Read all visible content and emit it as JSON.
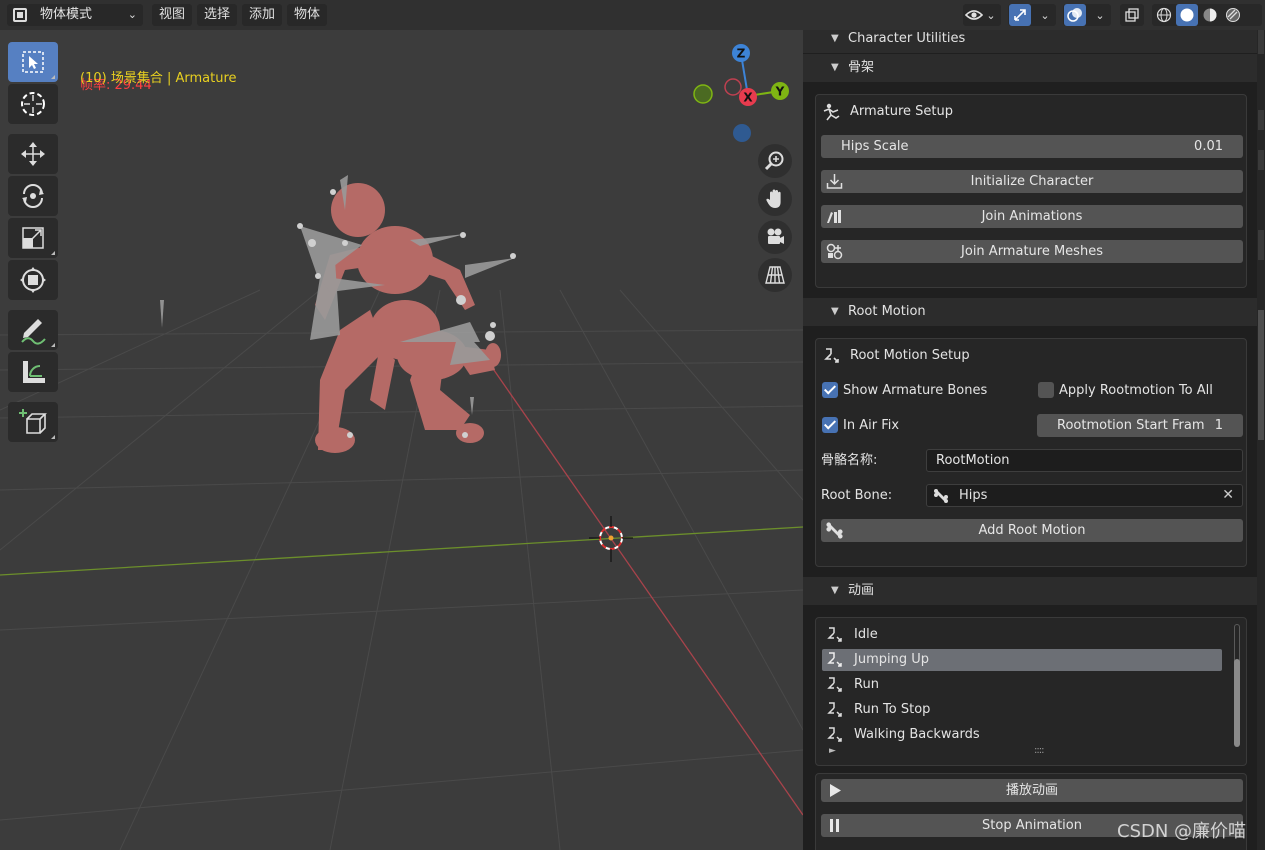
{
  "header": {
    "mode": "物体模式",
    "menus": [
      "视图",
      "选择",
      "添加",
      "物体"
    ]
  },
  "viewport": {
    "fps_text": "帧率: 29.44",
    "scene_text": "(10) 场景集合 | Armature",
    "gizmo": {
      "x": "X",
      "y": "Y",
      "z": "Z"
    }
  },
  "panel": {
    "character_utilities": "Character Utilities",
    "skeleton_header": "骨架",
    "armature_setup": {
      "title": "Armature Setup",
      "hips_scale_label": "Hips Scale",
      "hips_scale_value": "0.01",
      "initialize": "Initialize Character",
      "join_animations": "Join Animations",
      "join_meshes": "Join Armature Meshes"
    },
    "root_motion_header": "Root Motion",
    "root_motion": {
      "title": "Root Motion Setup",
      "show_bones": "Show Armature Bones",
      "show_bones_checked": true,
      "apply_all": "Apply Rootmotion To All",
      "apply_all_checked": false,
      "in_air_fix": "In Air Fix",
      "in_air_fix_checked": true,
      "start_frame_label": "Rootmotion Start Fram",
      "start_frame_value": "1",
      "bone_name_label": "骨骼名称:",
      "bone_name_value": "RootMotion",
      "root_bone_label": "Root Bone:",
      "root_bone_value": "Hips",
      "add_root_motion": "Add Root Motion"
    },
    "animation_header": "动画",
    "animations": [
      "Idle",
      "Jumping Up",
      "Run",
      "Run To Stop",
      "Walking Backwards"
    ],
    "selected_animation": "Jumping Up",
    "list_grip": "::::",
    "play": "播放动画",
    "stop": "Stop Animation"
  },
  "watermark": "CSDN @廉价喵",
  "colors": {
    "accent": "#4772b3",
    "axis_x": "#e83b4e",
    "axis_y": "#7fb513",
    "axis_z": "#3d83d6",
    "fps": "#ff4040",
    "scene": "#e8d020"
  }
}
